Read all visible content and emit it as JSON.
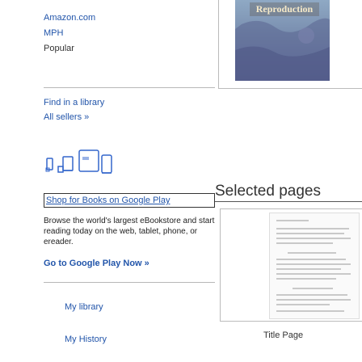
{
  "buy_links": {
    "amazon": "Amazon.com",
    "mph": "MPH",
    "popular": "Popular"
  },
  "find": {
    "library": "Find in a library",
    "sellers": "All sellers »"
  },
  "logo_text": "Google Books",
  "shop": {
    "link": "Shop for Books on Google Play",
    "description": "Browse the world's largest eBookstore and start reading today on the web, tablet, phone, or ereader.",
    "gplay": "Go to Google Play Now »"
  },
  "user_links": {
    "library": "My library",
    "history": "My History"
  },
  "cover": {
    "title": "Reproduction"
  },
  "selected_pages": "Selected pages",
  "thumbnail_caption": "Title Page",
  "colors": {
    "link": "#2255aa",
    "text": "#222222",
    "border": "#bbbbbb"
  }
}
